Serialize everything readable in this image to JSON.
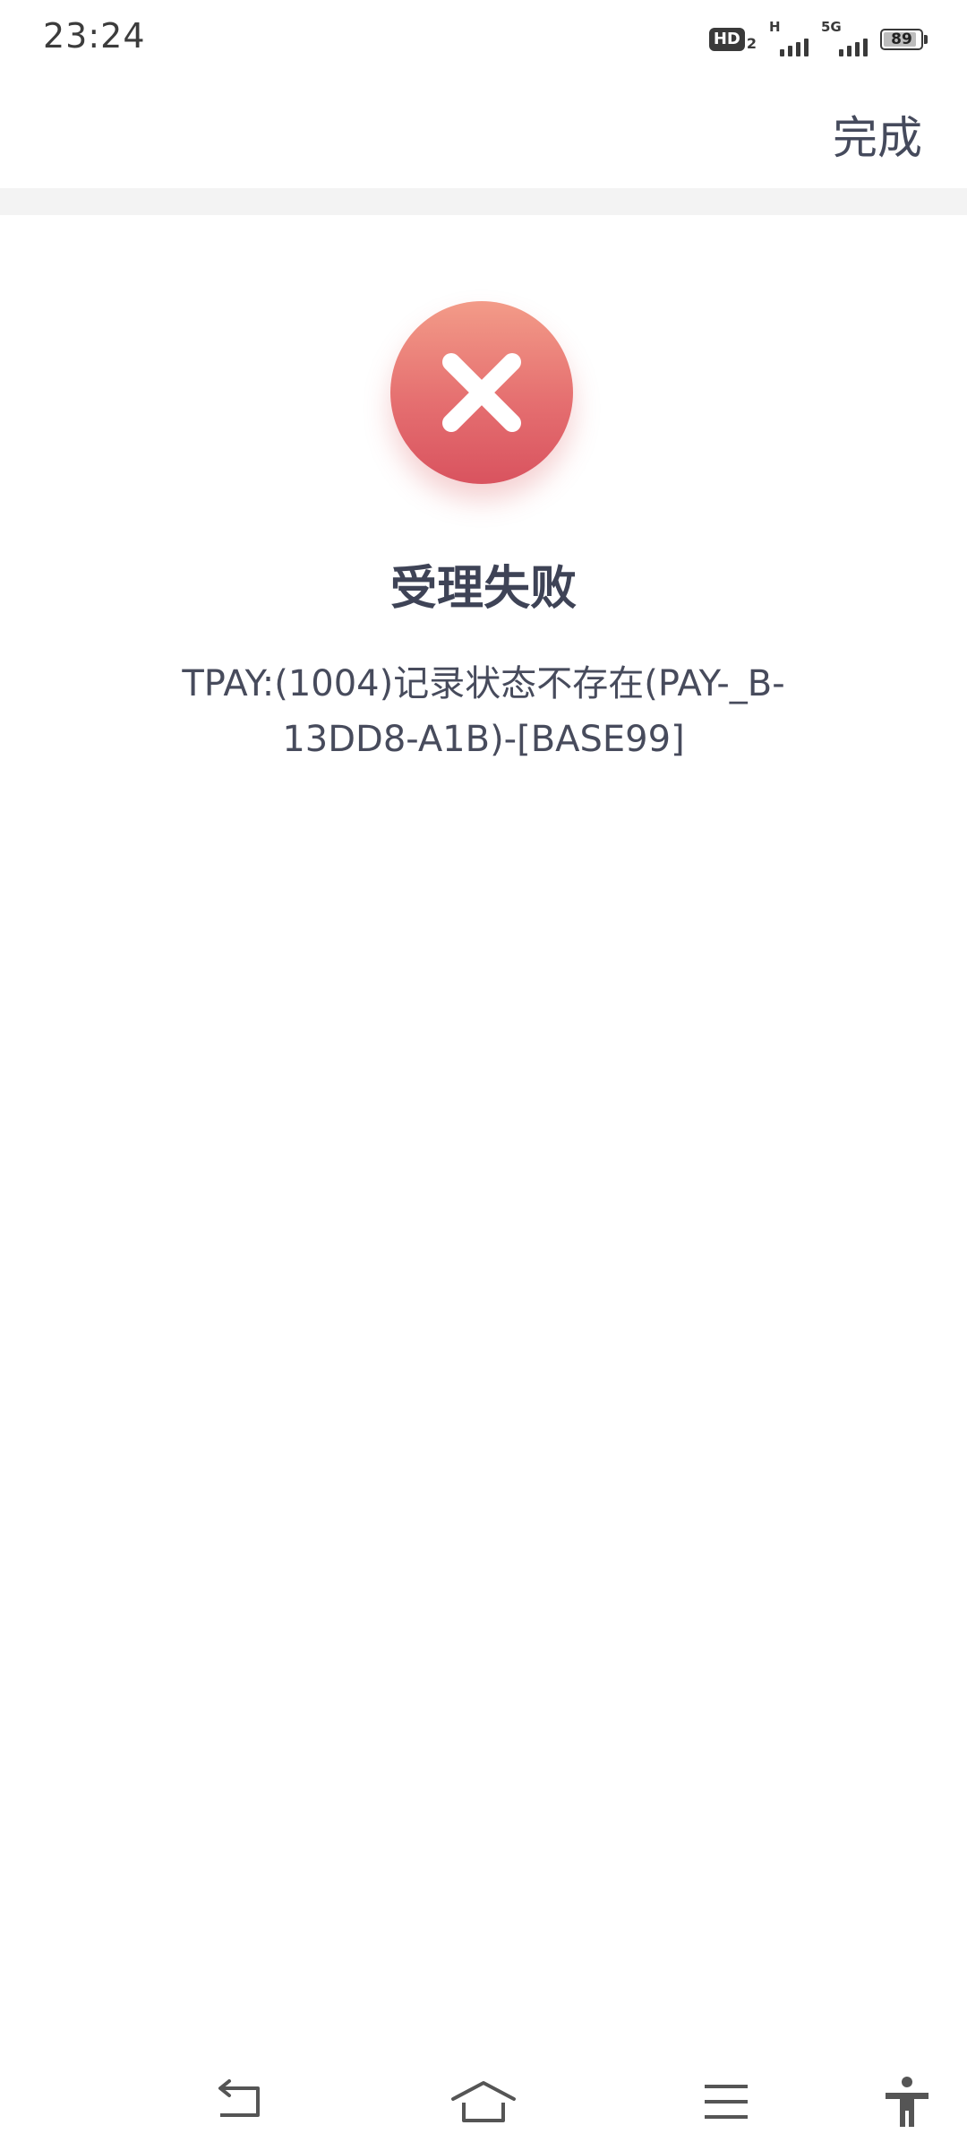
{
  "status_bar": {
    "time": "23:24",
    "hd_label": "HD",
    "hd_sub": "2",
    "signal1_tag": "H",
    "signal2_tag": "5G",
    "battery_level": "89",
    "battery_fraction": 0.89
  },
  "header": {
    "done_label": "完成"
  },
  "result": {
    "icon": "close-icon",
    "status_color": "#e56f70",
    "title": "受理失败",
    "message": "TPAY:(1004)记录状态不存在(PAY-_B-13DD8-A1B)-[BASE99]"
  },
  "nav": {
    "icons": [
      "back-icon",
      "home-icon",
      "menu-icon",
      "accessibility-icon"
    ]
  }
}
